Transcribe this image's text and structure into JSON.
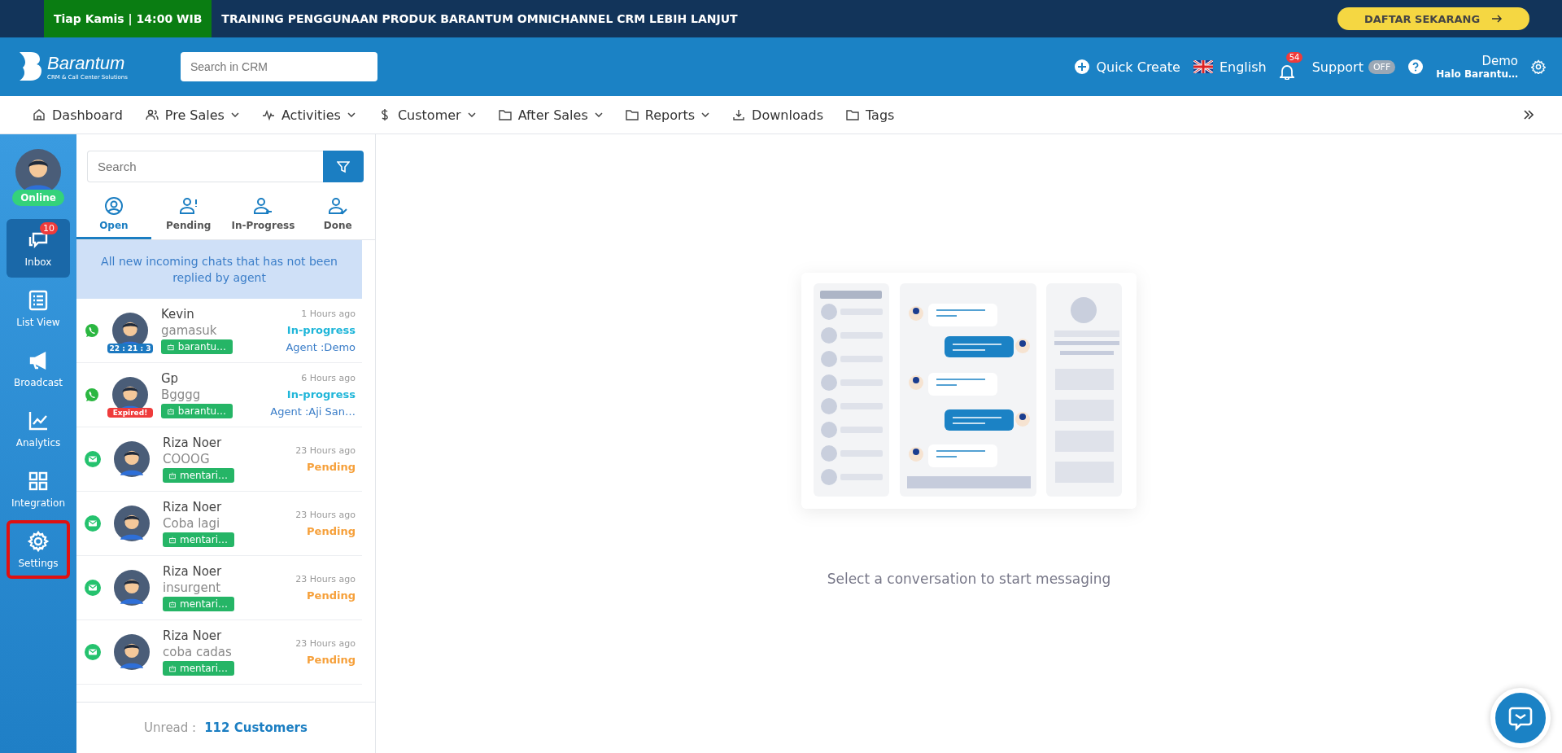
{
  "banner": {
    "schedule": "Tiap Kamis | 14:00 WIB",
    "title": "TRAINING PENGGUNAAN PRODUK BARANTUM OMNICHANNEL CRM LEBIH LANJUT",
    "button": "DAFTAR SEKARANG"
  },
  "header": {
    "brand": "Barantum",
    "tagline": "CRM & Call Center Solutions",
    "search": {
      "placeholder": "Search in CRM"
    },
    "quick_create": "Quick Create",
    "language": "English",
    "notifications": "54",
    "support": {
      "label": "Support",
      "toggle": "OFF",
      "on": false
    },
    "user": {
      "name": "Demo",
      "company": "Halo Barantu…"
    }
  },
  "nav": [
    {
      "label": "Dashboard",
      "kind": "home",
      "dropdown": false
    },
    {
      "label": "Pre Sales",
      "kind": "users",
      "dropdown": true
    },
    {
      "label": "Activities",
      "kind": "pulse",
      "dropdown": true
    },
    {
      "label": "Customer",
      "kind": "dollar",
      "dropdown": true
    },
    {
      "label": "After Sales",
      "kind": "folder",
      "dropdown": true
    },
    {
      "label": "Reports",
      "kind": "folder",
      "dropdown": true
    },
    {
      "label": "Downloads",
      "kind": "download",
      "dropdown": false
    },
    {
      "label": "Tags",
      "kind": "folder",
      "dropdown": false
    }
  ],
  "sidebar": {
    "status": "Online",
    "items": [
      {
        "label": "Inbox",
        "kind": "inbox",
        "badge": "10",
        "selected": true,
        "highlighted": false
      },
      {
        "label": "List View",
        "kind": "list",
        "selected": false,
        "highlighted": false
      },
      {
        "label": "Broadcast",
        "kind": "megaphone",
        "selected": false,
        "highlighted": false
      },
      {
        "label": "Analytics",
        "kind": "chart",
        "selected": false,
        "highlighted": false
      },
      {
        "label": "Integration",
        "kind": "grid",
        "selected": false,
        "highlighted": false
      },
      {
        "label": "Settings",
        "kind": "gear",
        "selected": false,
        "highlighted": true
      }
    ]
  },
  "chat_list": {
    "search": {
      "placeholder": "Search"
    },
    "tabs": [
      {
        "label": "Open",
        "kind": "open",
        "selected": true
      },
      {
        "label": "Pending",
        "kind": "pending",
        "selected": false
      },
      {
        "label": "In-Progress",
        "kind": "progress",
        "selected": false
      },
      {
        "label": "Done",
        "kind": "done",
        "selected": false
      }
    ],
    "notice": "All new incoming chats that has not been replied by agent",
    "chats": [
      {
        "kind": "whatsapp",
        "name": "Kevin",
        "message": "gamasuk",
        "tag": "barantu…",
        "time": "1 Hours ago",
        "status": "In-progress",
        "color": "#1fb6d9",
        "agent": "Agent :Demo",
        "avatar_badge": {
          "text": "22 : 21 : 3",
          "color": "#1b78c0"
        }
      },
      {
        "kind": "whatsapp",
        "name": "Gp",
        "message": "Bgggg",
        "tag": "barantu…",
        "time": "6 Hours ago",
        "status": "In-progress",
        "color": "#1fb6d9",
        "agent": "Agent :Aji San…",
        "avatar_badge": {
          "text": "Expired!",
          "color": "#ef3b3b"
        }
      },
      {
        "kind": "email",
        "name": "Riza Noer",
        "message": "COOOG",
        "tag": "mentari…",
        "time": "23 Hours ago",
        "status": "Pending",
        "color": "#f6a03a"
      },
      {
        "kind": "email",
        "name": "Riza Noer",
        "message": "Coba lagi",
        "tag": "mentari…",
        "time": "23 Hours ago",
        "status": "Pending",
        "color": "#f6a03a"
      },
      {
        "kind": "email",
        "name": "Riza Noer",
        "message": "insurgent",
        "tag": "mentari…",
        "time": "23 Hours ago",
        "status": "Pending",
        "color": "#f6a03a"
      },
      {
        "kind": "email",
        "name": "Riza Noer",
        "message": "coba cadas",
        "tag": "mentari…",
        "time": "23 Hours ago",
        "status": "Pending",
        "color": "#f6a03a"
      }
    ],
    "footer": {
      "label": "Unread :",
      "count": "112 Customers"
    }
  },
  "main": {
    "empty_message": "Select a conversation to start messaging"
  }
}
